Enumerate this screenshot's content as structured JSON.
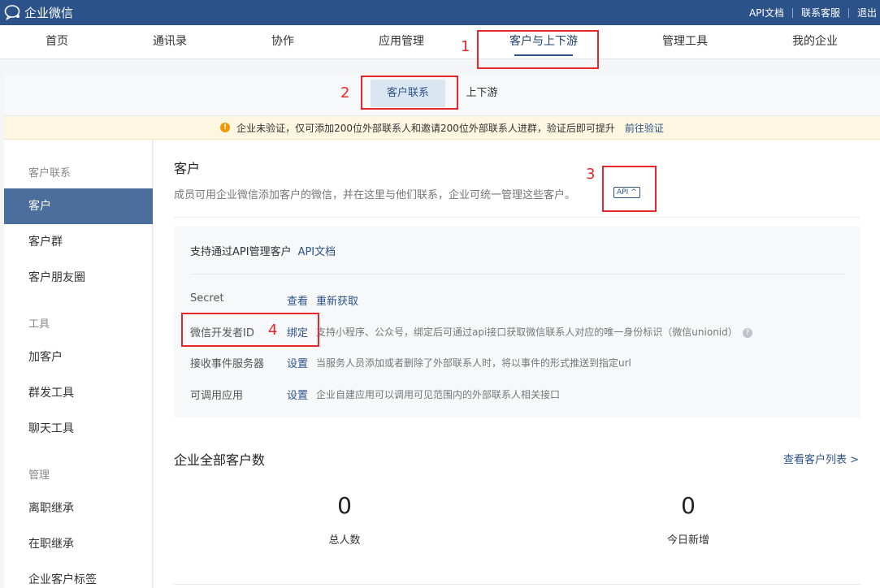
{
  "topbar": {
    "logo_text": "企业微信",
    "links": [
      "API文档",
      "联系客服",
      "退出"
    ]
  },
  "mainnav": {
    "items": [
      "首页",
      "通讯录",
      "协作",
      "应用管理",
      "客户与上下游",
      "管理工具",
      "我的企业"
    ],
    "active": "客户与上下游"
  },
  "subnav": {
    "tabs": [
      "客户联系",
      "上下游"
    ],
    "active": "客户联系"
  },
  "notice": {
    "text": "企业未验证，仅可添加200位外部联系人和邀请200位外部联系人进群，验证后即可提升",
    "link": "前往验证"
  },
  "sidebar": {
    "groups": [
      {
        "title": "客户联系",
        "items": [
          "客户",
          "客户群",
          "客户朋友圈"
        ]
      },
      {
        "title": "工具",
        "items": [
          "加客户",
          "群发工具",
          "聊天工具"
        ]
      },
      {
        "title": "管理",
        "items": [
          "离职继承",
          "在职继承",
          "企业客户标签"
        ]
      }
    ],
    "active": "客户"
  },
  "content": {
    "title": "客户",
    "description": "成员可用企业微信添加客户的微信，并在这里与他们联系，企业可统一管理这些客户。",
    "api_badge": "API ^",
    "api_box": {
      "heading": "支持通过API管理客户",
      "heading_link": "API文档",
      "rows": [
        {
          "label": "Secret",
          "links": [
            "查看",
            "重新获取"
          ],
          "desc": ""
        },
        {
          "label": "微信开发者ID",
          "links": [
            "绑定"
          ],
          "desc": "支持小程序、公众号，绑定后可通过api接口获取微信联系人对应的唯一身份标识（微信unionid）"
        },
        {
          "label": "接收事件服务器",
          "links": [
            "设置"
          ],
          "desc": "当服务人员添加或者删除了外部联系人时，将以事件的形式推送到指定url"
        },
        {
          "label": "可调用应用",
          "links": [
            "设置"
          ],
          "desc": "企业自建应用可以调用可见范围内的外部联系人相关接口"
        }
      ]
    },
    "stats": {
      "title": "企业全部客户数",
      "view_link": "查看客户列表 >",
      "items": [
        {
          "value": "0",
          "label": "总人数"
        },
        {
          "value": "0",
          "label": "今日新增"
        }
      ]
    }
  },
  "annotations": [
    "1",
    "2",
    "3",
    "4"
  ],
  "colors": {
    "topbar": "#2b5389",
    "accent": "#2b5389",
    "sidebar_active": "#4b6e9d",
    "annotation": "#e8262c",
    "notice_bg": "#fdf6e0",
    "warn": "#f39800"
  }
}
